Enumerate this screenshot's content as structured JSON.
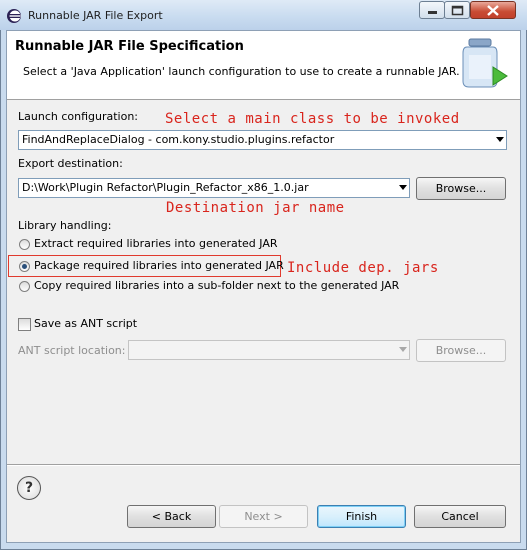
{
  "window": {
    "title": "Runnable JAR File Export"
  },
  "banner": {
    "title": "Runnable JAR File Specification",
    "subtitle": "Select a 'Java Application' launch configuration to use to create a runnable JAR."
  },
  "launch": {
    "label": "Launch configuration:",
    "value": "FindAndReplaceDialog - com.kony.studio.plugins.refactor"
  },
  "export": {
    "label": "Export destination:",
    "value": "D:\\Work\\Plugin Refactor\\Plugin_Refactor_x86_1.0.jar",
    "browse": "Browse..."
  },
  "library": {
    "label": "Library handling:",
    "options": [
      {
        "label": "Extract required libraries into generated JAR",
        "selected": false
      },
      {
        "label": "Package required libraries into generated JAR",
        "selected": true
      },
      {
        "label": "Copy required libraries into a sub-folder next to the generated JAR",
        "selected": false
      }
    ]
  },
  "ant": {
    "checkbox_label": "Save as ANT script",
    "checked": false,
    "location_label": "ANT script location:",
    "location_value": "",
    "browse": "Browse..."
  },
  "annotations": {
    "main_class": "Select a main class to be invoked",
    "dest_name": "Destination jar name",
    "include_jars": "Include dep. jars",
    "color": "#d9251d"
  },
  "footer": {
    "help_icon": "help-icon",
    "back": "< Back",
    "next": "Next >",
    "finish": "Finish",
    "cancel": "Cancel"
  }
}
